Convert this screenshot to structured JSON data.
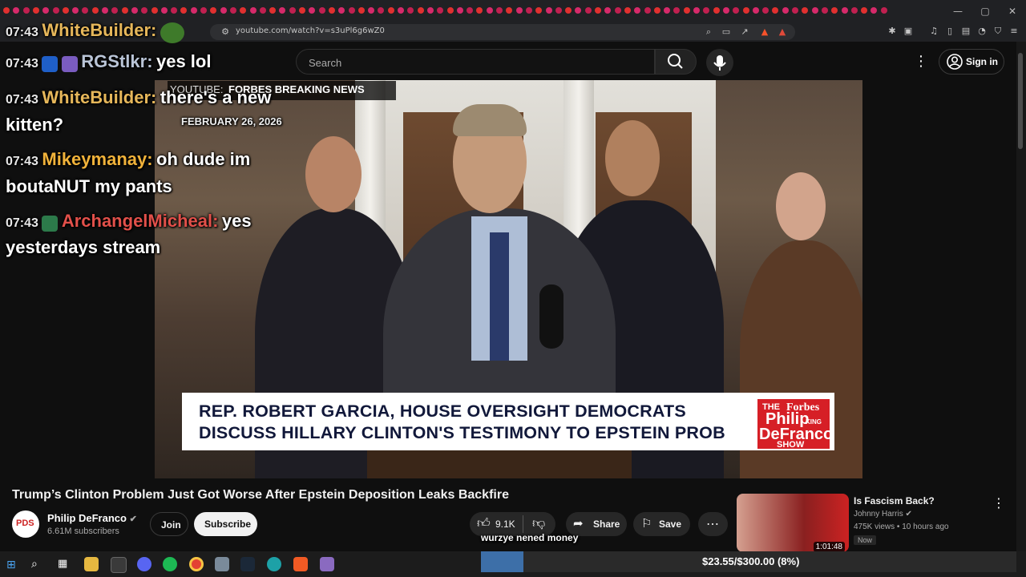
{
  "browser": {
    "url": "youtube.com/watch?v=s3uPl6g6wZ0"
  },
  "header": {
    "search_placeholder": "Search",
    "sign_in": "Sign in"
  },
  "video": {
    "source_label_prefix": "YOUTUBE:",
    "source_label": "FORBES BREAKING NEWS",
    "date": "FEBRUARY 26, 2026",
    "chyron_line1": "REP. ROBERT GARCIA, HOUSE OVERSIGHT DEMOCRATS",
    "chyron_line2": "DISCUSS HILLARY CLINTON'S TESTIMONY TO EPSTEIN PROB",
    "logo_the": "THE",
    "logo_philip": "Philip",
    "logo_defranco": "DeFranco",
    "logo_show": "SHOW",
    "logo_forbes": "Forbes",
    "logo_king": "KING"
  },
  "chat": [
    {
      "time": "07:43",
      "user": "WhiteBuilder:",
      "user_color": "#e6b75a",
      "msg": ""
    },
    {
      "time": "07:43",
      "user": "RGStlkr:",
      "user_color": "#b9c4d6",
      "msg": "yes lol"
    },
    {
      "time": "07:43",
      "user": "WhiteBuilder:",
      "user_color": "#e6b75a",
      "msg": "there's a new",
      "msg2": "kitten?"
    },
    {
      "time": "07:43",
      "user": "Mikeymanay:",
      "user_color": "#f0b23a",
      "msg": "oh dude im",
      "msg2": "boutaNUT my pants"
    },
    {
      "time": "07:43",
      "user": "ArchangelMicheal:",
      "user_color": "#e2504a",
      "msg": "yes",
      "msg2": "yesterdays stream"
    }
  ],
  "below": {
    "title": "Trump’s Clinton Problem Just Got Worse After Epstein Deposition Leaks Backfire",
    "channel": "Philip DeFranco",
    "subscribers": "6.61M subscribers",
    "join": "Join",
    "subscribe": "Subscribe",
    "likes": "9.1K",
    "share": "Share",
    "save": "Save",
    "avatar_text": "PDS"
  },
  "recommended": {
    "title": "Is Fascism Back?",
    "channel": "Johnny Harris",
    "meta": "475K views • 10 hours ago",
    "badge": "Now",
    "duration": "1:01:48"
  },
  "overlay": {
    "tts_text": "wurzye nened money",
    "goal_text": "$23.55/$300.00 (8%)",
    "goal_fraction": 0.08
  },
  "colors": {
    "accent_red": "#d61f26",
    "subscribe_bg": "#f1f1f1"
  }
}
